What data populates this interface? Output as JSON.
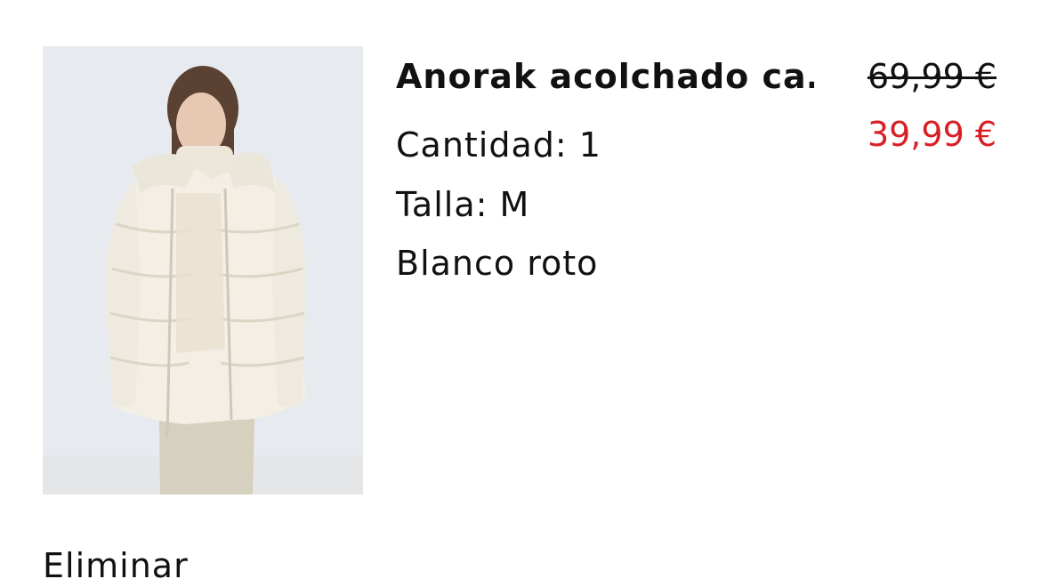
{
  "item": {
    "image_alt": "product-photo",
    "title": "Anorak acolchado ca…",
    "quantity": "Cantidad: 1",
    "size": "Talla: M",
    "color_name": "Blanco roto",
    "price_original": "69,99 €",
    "price_sale": "39,99 €",
    "remove_label": "Eliminar"
  },
  "colors": {
    "sale_price": "#d81f26",
    "text": "#111111",
    "jacket": "#f3efe5"
  }
}
